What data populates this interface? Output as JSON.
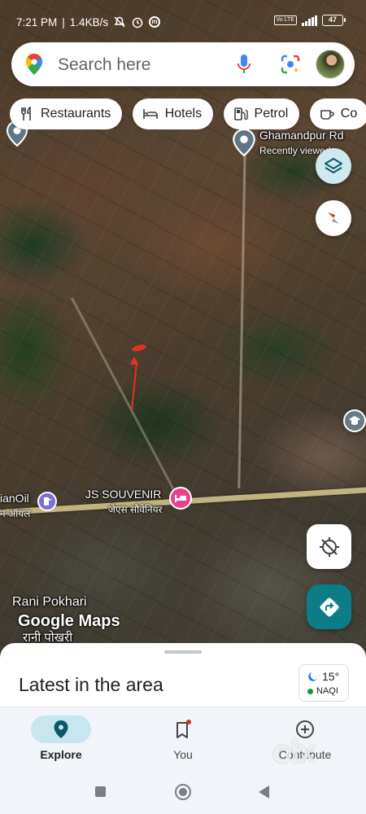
{
  "status_bar": {
    "time": "7:21 PM",
    "speed": "1.4KB/s",
    "volte": "Vo LTE",
    "battery": "47"
  },
  "search": {
    "placeholder": "Search here",
    "icons": [
      "google-maps-pin-icon",
      "microphone-icon",
      "lens-icon",
      "avatar"
    ]
  },
  "chips": [
    {
      "label": "Restaurants",
      "icon": "fork-knife-icon"
    },
    {
      "label": "Hotels",
      "icon": "bed-icon"
    },
    {
      "label": "Petrol",
      "icon": "fuel-pump-icon"
    },
    {
      "label": "Co",
      "icon": "coffee-cup-icon"
    }
  ],
  "map": {
    "recent_place": {
      "name": "Ghamandpur Rd",
      "subtitle": "Recently viewed"
    },
    "hotel": {
      "name": "JS SOUVENIR",
      "name_hindi": "जेएस सौवेनियर"
    },
    "indianoil": {
      "name": "ianOil",
      "name_hindi": "न ऑयल"
    },
    "village": {
      "name": "Rani Pokhari",
      "name_hindi": "रानी पोखरी"
    },
    "logo": "Google Maps"
  },
  "colors": {
    "brand_teal": "#0b7d86",
    "hotel_pink": "#e8428c",
    "arrow_red": "#e8321e",
    "nav_active": "#c8e6ef"
  },
  "sheet": {
    "title": "Latest in the area",
    "weather": {
      "temp": "15°",
      "aqi": "NAQI"
    }
  },
  "nav": [
    {
      "label": "Explore",
      "icon": "explore-pin-icon",
      "active": true
    },
    {
      "label": "You",
      "icon": "bookmark-icon",
      "active": false
    },
    {
      "label": "Contribute",
      "icon": "add-circle-icon",
      "active": false
    }
  ],
  "watermark": "olx"
}
